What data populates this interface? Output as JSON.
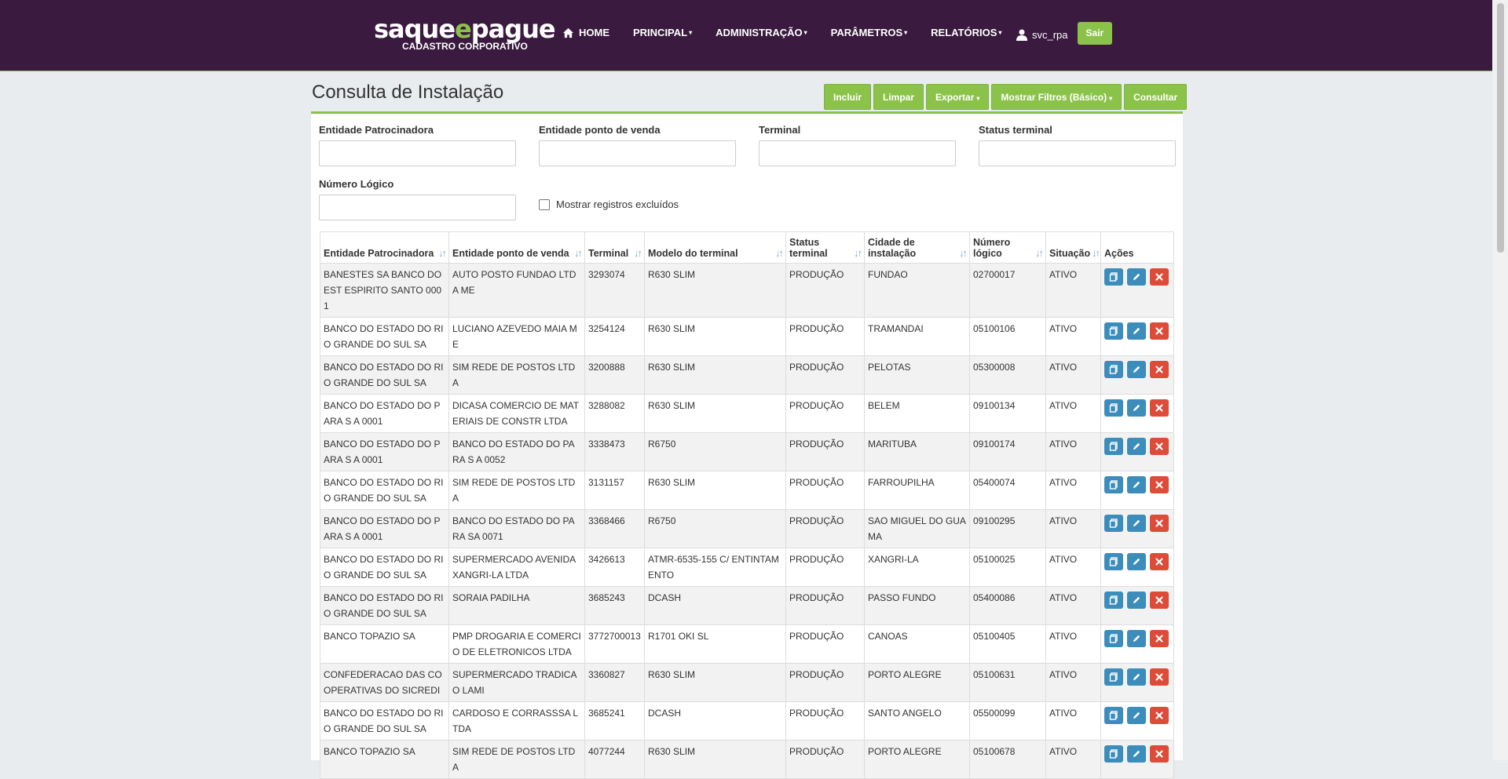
{
  "brand": {
    "name_part1": "saque",
    "name_e": "e",
    "name_part2": "pague",
    "subtitle": "CADASTRO CORPORATIVO"
  },
  "nav": {
    "items": [
      {
        "label": "HOME",
        "icon": "home-icon"
      },
      {
        "label": "PRINCIPAL",
        "caret": "▾"
      },
      {
        "label": "ADMINISTRAÇÃO",
        "caret": "▾"
      },
      {
        "label": "PARÂMETROS",
        "caret": "▾"
      },
      {
        "label": "RELATÓRIOS",
        "caret": "▾"
      }
    ],
    "user": {
      "name": "svc_rpa",
      "icon": "user-icon"
    },
    "logout_label": "Sair"
  },
  "page": {
    "title": "Consulta de Instalação"
  },
  "toolbar": {
    "incluir": "Incluir",
    "limpar": "Limpar",
    "exportar": "Exportar",
    "filtros": "Mostrar Filtros (Básico)",
    "consultar": "Consultar",
    "caret": "▾"
  },
  "filters": {
    "entidade_patrocinadora": {
      "label": "Entidade Patrocinadora",
      "value": ""
    },
    "entidade_pdv": {
      "label": "Entidade ponto de venda",
      "value": ""
    },
    "terminal": {
      "label": "Terminal",
      "value": ""
    },
    "status_terminal": {
      "label": "Status terminal",
      "value": ""
    },
    "numero_logico": {
      "label": "Número Lógico",
      "value": ""
    },
    "mostrar_excluidos": {
      "label": "Mostrar registros excluídos",
      "checked": false
    }
  },
  "table": {
    "sort_icon": "↓↑",
    "columns": [
      "Entidade Patrocinadora",
      "Entidade ponto de venda",
      "Terminal",
      "Modelo do terminal",
      "Status terminal",
      "Cidade de instalação",
      "Número lógico",
      "Situação",
      "Ações"
    ],
    "rows": [
      [
        "BANESTES SA BANCO DO EST ESPIRITO SANTO 0001",
        "AUTO POSTO FUNDAO LTDA ME",
        "3293074",
        "R630 SLIM",
        "PRODUÇÃO",
        "FUNDAO",
        "02700017",
        "ATIVO"
      ],
      [
        "BANCO DO ESTADO DO RIO GRANDE DO SUL SA",
        "LUCIANO AZEVEDO MAIA ME",
        "3254124",
        "R630 SLIM",
        "PRODUÇÃO",
        "TRAMANDAI",
        "05100106",
        "ATIVO"
      ],
      [
        "BANCO DO ESTADO DO RIO GRANDE DO SUL SA",
        "SIM REDE DE POSTOS LTDA",
        "3200888",
        "R630 SLIM",
        "PRODUÇÃO",
        "PELOTAS",
        "05300008",
        "ATIVO"
      ],
      [
        "BANCO DO ESTADO DO PARA S A 0001",
        "DICASA COMERCIO DE MATERIAIS DE CONSTR LTDA",
        "3288082",
        "R630 SLIM",
        "PRODUÇÃO",
        "BELEM",
        "09100134",
        "ATIVO"
      ],
      [
        "BANCO DO ESTADO DO PARA S A 0001",
        "BANCO DO ESTADO DO PARA S A 0052",
        "3338473",
        "R6750",
        "PRODUÇÃO",
        "MARITUBA",
        "09100174",
        "ATIVO"
      ],
      [
        "BANCO DO ESTADO DO RIO GRANDE DO SUL SA",
        "SIM REDE DE POSTOS LTDA",
        "3131157",
        "R630 SLIM",
        "PRODUÇÃO",
        "FARROUPILHA",
        "05400074",
        "ATIVO"
      ],
      [
        "BANCO DO ESTADO DO PARA S A 0001",
        "BANCO DO ESTADO DO PARA SA 0071",
        "3368466",
        "R6750",
        "PRODUÇÃO",
        "SAO MIGUEL DO GUAMA",
        "09100295",
        "ATIVO"
      ],
      [
        "BANCO DO ESTADO DO RIO GRANDE DO SUL SA",
        "SUPERMERCADO AVENIDA XANGRI-LA LTDA",
        "3426613",
        "ATMR-6535-155 C/ ENTINTAMENTO",
        "PRODUÇÃO",
        "XANGRI-LA",
        "05100025",
        "ATIVO"
      ],
      [
        "BANCO DO ESTADO DO RIO GRANDE DO SUL SA",
        "SORAIA PADILHA",
        "3685243",
        "DCASH",
        "PRODUÇÃO",
        "PASSO FUNDO",
        "05400086",
        "ATIVO"
      ],
      [
        "BANCO TOPAZIO SA",
        "PMP DROGARIA E COMERCIO DE ELETRONICOS LTDA",
        "3772700013",
        "R1701 OKI SL",
        "PRODUÇÃO",
        "CANOAS",
        "05100405",
        "ATIVO"
      ],
      [
        "CONFEDERACAO DAS COOPERATIVAS DO SICREDI",
        "SUPERMERCADO TRADICAO LAMI",
        "3360827",
        "R630 SLIM",
        "PRODUÇÃO",
        "PORTO ALEGRE",
        "05100631",
        "ATIVO"
      ],
      [
        "BANCO DO ESTADO DO RIO GRANDE DO SUL SA",
        "CARDOSO E CORRASSSA LTDA",
        "3685241",
        "DCASH",
        "PRODUÇÃO",
        "SANTO ANGELO",
        "05500099",
        "ATIVO"
      ],
      [
        "BANCO TOPAZIO SA",
        "SIM REDE DE POSTOS LTDA",
        "4077244",
        "R630 SLIM",
        "PRODUÇÃO",
        "PORTO ALEGRE",
        "05100678",
        "ATIVO"
      ]
    ]
  },
  "colors": {
    "navbar": "#3a1a3f",
    "accent": "#8bc34a",
    "action_blue": "#3c8dbc",
    "action_red": "#dd4b39"
  }
}
